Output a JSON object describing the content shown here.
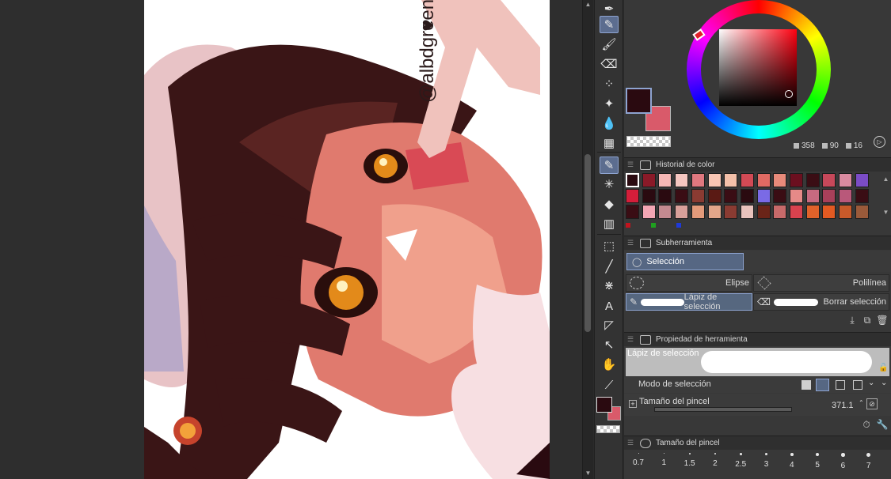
{
  "canvas": {
    "watermark": "@albdgreen",
    "heart": "♥"
  },
  "tools": [
    {
      "icon": "pen-icon",
      "glyph": "✒",
      "active": false
    },
    {
      "icon": "pencil-icon",
      "glyph": "✎",
      "active": true
    },
    {
      "icon": "brush-icon",
      "glyph": "🖌",
      "active": false
    },
    {
      "icon": "eraser-icon",
      "glyph": "⌫",
      "active": false
    },
    {
      "icon": "spray-icon",
      "glyph": "⁘",
      "active": false
    },
    {
      "icon": "decoration-icon",
      "glyph": "✦",
      "active": false
    },
    {
      "icon": "blend-icon",
      "glyph": "💧",
      "active": false
    },
    {
      "icon": "grid-icon",
      "glyph": "▦",
      "active": false
    },
    {
      "icon": "selection-pen-icon",
      "glyph": "✎",
      "active": true
    },
    {
      "icon": "magic-wand-icon",
      "glyph": "✳",
      "active": false
    },
    {
      "icon": "fill-icon",
      "glyph": "◆",
      "active": false
    },
    {
      "icon": "gradient-icon",
      "glyph": "▥",
      "active": false
    },
    {
      "icon": "operation-icon",
      "glyph": "⬚",
      "active": false
    },
    {
      "icon": "line-icon",
      "glyph": "╱",
      "active": false
    },
    {
      "icon": "pattern-icon",
      "glyph": "⋇",
      "active": false
    },
    {
      "icon": "text-icon",
      "glyph": "A",
      "active": false
    },
    {
      "icon": "balloon-icon",
      "glyph": "◸",
      "active": false
    },
    {
      "icon": "move-layer-icon",
      "glyph": "↖",
      "active": false
    },
    {
      "icon": "hand-icon",
      "glyph": "✋",
      "active": false
    },
    {
      "icon": "eyedropper-icon",
      "glyph": "⟋",
      "active": false
    }
  ],
  "colors": {
    "main": "#2a0a10",
    "sub": "#d95a6a",
    "hue_marker": "#ffffff",
    "accent": "#8ea4d1"
  },
  "color_values": {
    "h": "358",
    "s": "90",
    "v": "16",
    "h_label": "H",
    "s_label": "S",
    "v_label": "V"
  },
  "color_history": {
    "title": "Historial de color",
    "rows": [
      [
        "#2a0a10",
        "#8a1a28",
        "#f6b7b5",
        "#f5c6c0",
        "#e0787f",
        "#f8c5b3",
        "#f4c0a9",
        "#d24a55",
        "#e06a63",
        "#e88a7a",
        "#6b0f1f",
        "#3a0d14",
        "#c7485a",
        "#d98aa0",
        "#7b4cc6"
      ],
      [
        "#d41e3a",
        "#2a0a10",
        "#2a0a10",
        "#3a0d14",
        "#8a3b32",
        "#5a1a14",
        "#3a0d14",
        "#2a0a10",
        "#7a6ae6",
        "#3a0d14",
        "#e68a88",
        "#c76a80",
        "#a8405a",
        "#b9587a",
        "#3a0d14"
      ],
      [
        "#3a0d14",
        "#f3a6b4",
        "#c48a90",
        "#d9a09a",
        "#e39a7a",
        "#e3a68a",
        "#8a3b32",
        "#e8c2bc",
        "#6a2418",
        "#c86a6a",
        "#d9424e",
        "#e0622a",
        "#e35a22",
        "#c85a2a",
        "#9a5a3a"
      ]
    ],
    "markers": [
      "#c0141e",
      "#1fa01f",
      "#1f3ad8"
    ]
  },
  "subtool": {
    "title": "Subherramienta",
    "group": "Selección",
    "items": [
      "Elipse",
      "Polilínea",
      "Lápiz de selección",
      "Borrar selección"
    ]
  },
  "tool_property": {
    "title": "Propiedad de herramienta",
    "tool_name": "Lápiz de selección",
    "mode_label": "Modo de selección",
    "size_label": "Tamaño del pincel",
    "size_value": "371.1"
  },
  "brush_size": {
    "title": "Tamaño del pincel",
    "sizes": [
      "0.7",
      "1",
      "1.5",
      "2",
      "2.5",
      "3",
      "4",
      "5",
      "6",
      "7"
    ]
  }
}
